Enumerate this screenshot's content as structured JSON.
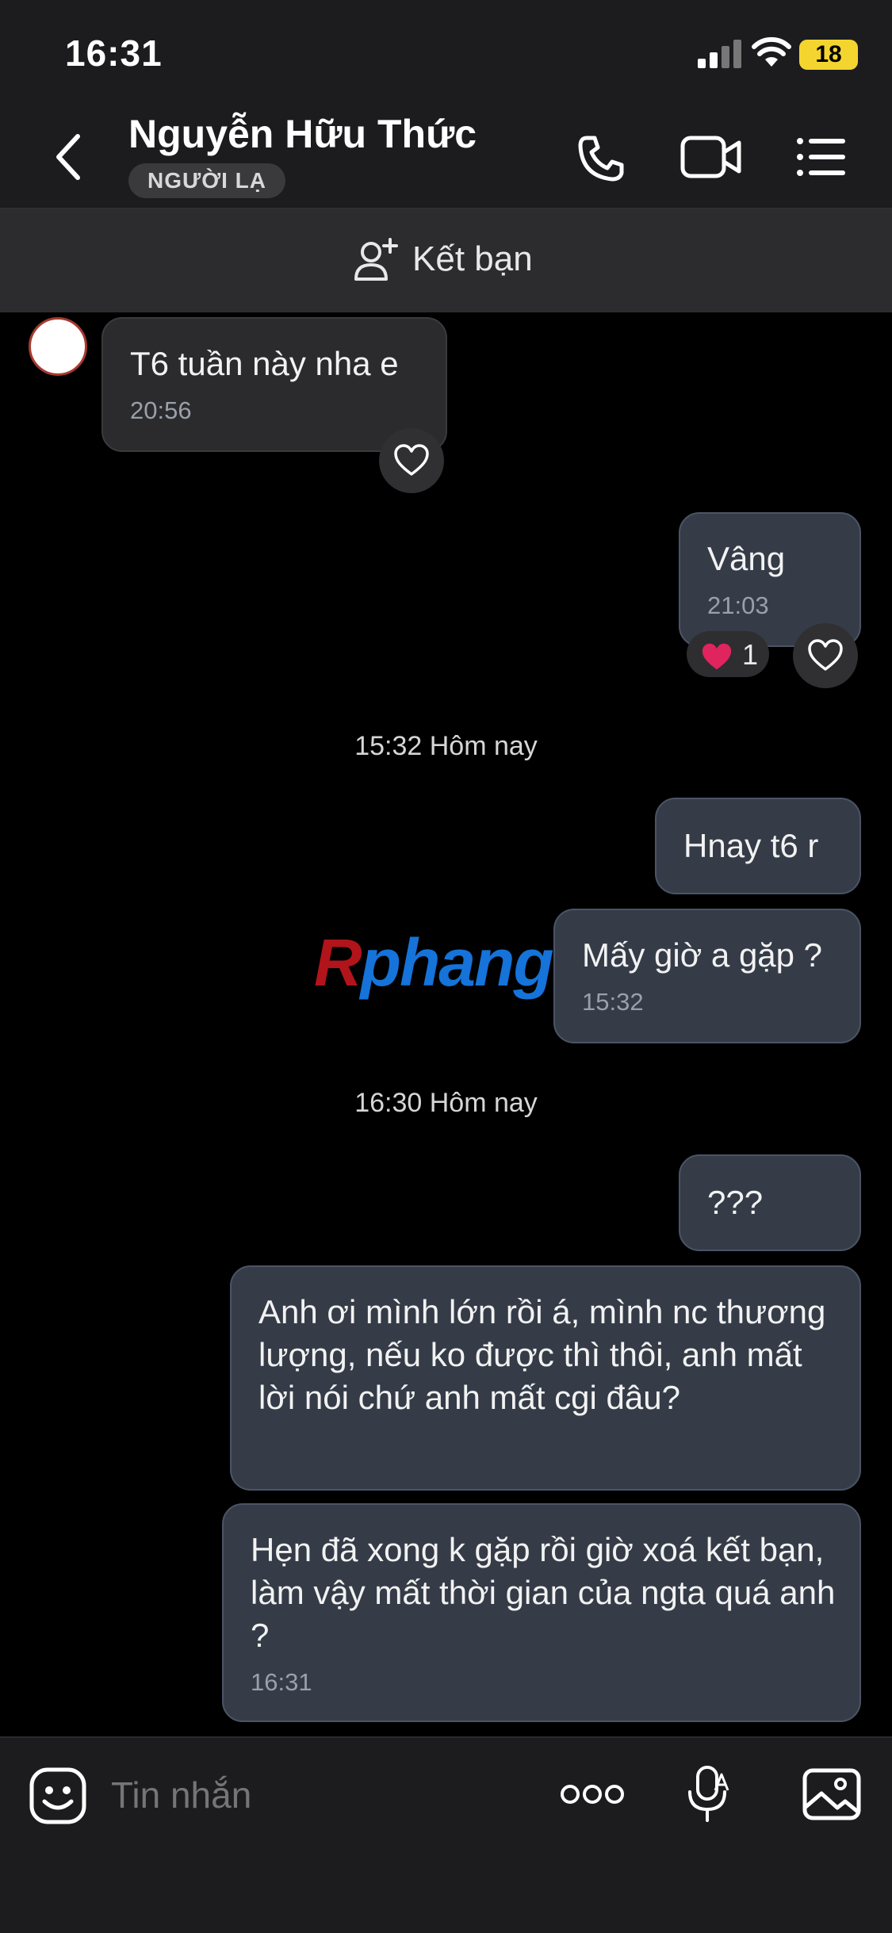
{
  "status_bar": {
    "time": "16:31",
    "battery": "18"
  },
  "header": {
    "contact_name": "Nguyễn Hữu Thức",
    "badge": "NGƯỜI LẠ"
  },
  "add_friend": {
    "label": "Kết bạn"
  },
  "messages": [
    {
      "direction": "in",
      "text": "T6 tuần này nha e",
      "time": "20:56"
    },
    {
      "direction": "out",
      "text": "Vâng",
      "time": "21:03",
      "reaction": {
        "emoji": "❤️",
        "count": "1"
      }
    },
    {
      "direction": "out",
      "text": "Hnay t6 r"
    },
    {
      "direction": "out",
      "text": "Mấy giờ a gặp ?",
      "time": "15:32"
    },
    {
      "direction": "out",
      "text": "???"
    },
    {
      "direction": "out",
      "text": "Anh ơi mình lớn rồi á, mình nc thương lượng, nếu ko được thì thôi, anh mất lời nói chứ anh mất cgi đâu?"
    },
    {
      "direction": "out",
      "text": "Hẹn đã xong k gặp rồi giờ xoá kết bạn, làm vậy mất thời gian của ngta quá anh ?",
      "time": "16:31"
    }
  ],
  "dividers": [
    "15:32 Hôm nay",
    "16:30 Hôm nay"
  ],
  "watermark": {
    "part1": "R",
    "part2": "phang"
  },
  "composer": {
    "placeholder": "Tin nhắn"
  },
  "colors": {
    "accent_heart": "#e0245e",
    "battery": "#f4d52f"
  }
}
